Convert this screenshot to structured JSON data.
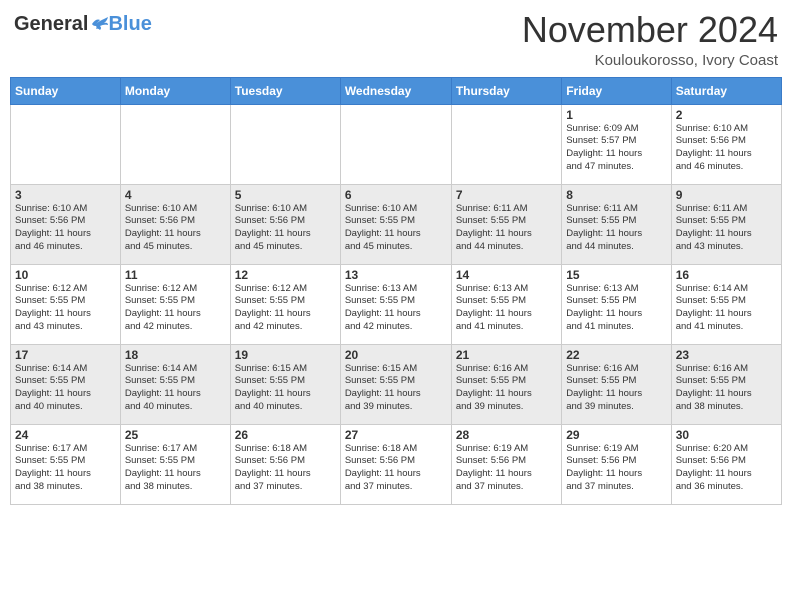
{
  "header": {
    "logo_general": "General",
    "logo_blue": "Blue",
    "month_title": "November 2024",
    "location": "Kouloukorosso, Ivory Coast"
  },
  "weekdays": [
    "Sunday",
    "Monday",
    "Tuesday",
    "Wednesday",
    "Thursday",
    "Friday",
    "Saturday"
  ],
  "weeks": [
    [
      {
        "day": "",
        "info": ""
      },
      {
        "day": "",
        "info": ""
      },
      {
        "day": "",
        "info": ""
      },
      {
        "day": "",
        "info": ""
      },
      {
        "day": "",
        "info": ""
      },
      {
        "day": "1",
        "info": "Sunrise: 6:09 AM\nSunset: 5:57 PM\nDaylight: 11 hours\nand 47 minutes."
      },
      {
        "day": "2",
        "info": "Sunrise: 6:10 AM\nSunset: 5:56 PM\nDaylight: 11 hours\nand 46 minutes."
      }
    ],
    [
      {
        "day": "3",
        "info": "Sunrise: 6:10 AM\nSunset: 5:56 PM\nDaylight: 11 hours\nand 46 minutes."
      },
      {
        "day": "4",
        "info": "Sunrise: 6:10 AM\nSunset: 5:56 PM\nDaylight: 11 hours\nand 45 minutes."
      },
      {
        "day": "5",
        "info": "Sunrise: 6:10 AM\nSunset: 5:56 PM\nDaylight: 11 hours\nand 45 minutes."
      },
      {
        "day": "6",
        "info": "Sunrise: 6:10 AM\nSunset: 5:55 PM\nDaylight: 11 hours\nand 45 minutes."
      },
      {
        "day": "7",
        "info": "Sunrise: 6:11 AM\nSunset: 5:55 PM\nDaylight: 11 hours\nand 44 minutes."
      },
      {
        "day": "8",
        "info": "Sunrise: 6:11 AM\nSunset: 5:55 PM\nDaylight: 11 hours\nand 44 minutes."
      },
      {
        "day": "9",
        "info": "Sunrise: 6:11 AM\nSunset: 5:55 PM\nDaylight: 11 hours\nand 43 minutes."
      }
    ],
    [
      {
        "day": "10",
        "info": "Sunrise: 6:12 AM\nSunset: 5:55 PM\nDaylight: 11 hours\nand 43 minutes."
      },
      {
        "day": "11",
        "info": "Sunrise: 6:12 AM\nSunset: 5:55 PM\nDaylight: 11 hours\nand 42 minutes."
      },
      {
        "day": "12",
        "info": "Sunrise: 6:12 AM\nSunset: 5:55 PM\nDaylight: 11 hours\nand 42 minutes."
      },
      {
        "day": "13",
        "info": "Sunrise: 6:13 AM\nSunset: 5:55 PM\nDaylight: 11 hours\nand 42 minutes."
      },
      {
        "day": "14",
        "info": "Sunrise: 6:13 AM\nSunset: 5:55 PM\nDaylight: 11 hours\nand 41 minutes."
      },
      {
        "day": "15",
        "info": "Sunrise: 6:13 AM\nSunset: 5:55 PM\nDaylight: 11 hours\nand 41 minutes."
      },
      {
        "day": "16",
        "info": "Sunrise: 6:14 AM\nSunset: 5:55 PM\nDaylight: 11 hours\nand 41 minutes."
      }
    ],
    [
      {
        "day": "17",
        "info": "Sunrise: 6:14 AM\nSunset: 5:55 PM\nDaylight: 11 hours\nand 40 minutes."
      },
      {
        "day": "18",
        "info": "Sunrise: 6:14 AM\nSunset: 5:55 PM\nDaylight: 11 hours\nand 40 minutes."
      },
      {
        "day": "19",
        "info": "Sunrise: 6:15 AM\nSunset: 5:55 PM\nDaylight: 11 hours\nand 40 minutes."
      },
      {
        "day": "20",
        "info": "Sunrise: 6:15 AM\nSunset: 5:55 PM\nDaylight: 11 hours\nand 39 minutes."
      },
      {
        "day": "21",
        "info": "Sunrise: 6:16 AM\nSunset: 5:55 PM\nDaylight: 11 hours\nand 39 minutes."
      },
      {
        "day": "22",
        "info": "Sunrise: 6:16 AM\nSunset: 5:55 PM\nDaylight: 11 hours\nand 39 minutes."
      },
      {
        "day": "23",
        "info": "Sunrise: 6:16 AM\nSunset: 5:55 PM\nDaylight: 11 hours\nand 38 minutes."
      }
    ],
    [
      {
        "day": "24",
        "info": "Sunrise: 6:17 AM\nSunset: 5:55 PM\nDaylight: 11 hours\nand 38 minutes."
      },
      {
        "day": "25",
        "info": "Sunrise: 6:17 AM\nSunset: 5:55 PM\nDaylight: 11 hours\nand 38 minutes."
      },
      {
        "day": "26",
        "info": "Sunrise: 6:18 AM\nSunset: 5:56 PM\nDaylight: 11 hours\nand 37 minutes."
      },
      {
        "day": "27",
        "info": "Sunrise: 6:18 AM\nSunset: 5:56 PM\nDaylight: 11 hours\nand 37 minutes."
      },
      {
        "day": "28",
        "info": "Sunrise: 6:19 AM\nSunset: 5:56 PM\nDaylight: 11 hours\nand 37 minutes."
      },
      {
        "day": "29",
        "info": "Sunrise: 6:19 AM\nSunset: 5:56 PM\nDaylight: 11 hours\nand 37 minutes."
      },
      {
        "day": "30",
        "info": "Sunrise: 6:20 AM\nSunset: 5:56 PM\nDaylight: 11 hours\nand 36 minutes."
      }
    ]
  ]
}
